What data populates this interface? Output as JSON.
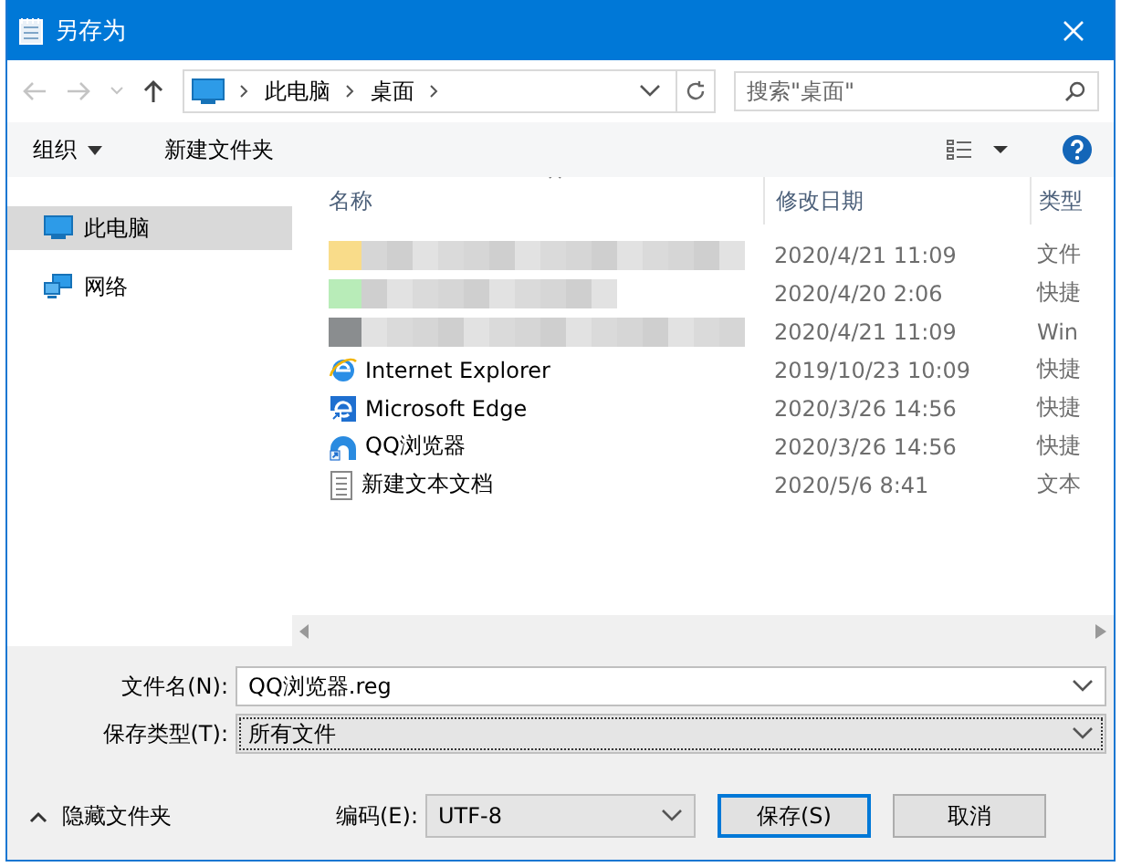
{
  "window": {
    "title": "另存为"
  },
  "address": {
    "path": [
      "此电脑",
      "桌面"
    ]
  },
  "search": {
    "placeholder": "搜索\"桌面\""
  },
  "toolbar": {
    "organize": "组织",
    "new_folder": "新建文件夹"
  },
  "sidebar": {
    "items": [
      {
        "label": "此电脑",
        "selected": true
      },
      {
        "label": "网络",
        "selected": false
      }
    ]
  },
  "table": {
    "columns": [
      "名称",
      "修改日期",
      "类型"
    ],
    "rows": [
      {
        "kind": "blurred",
        "date": "2020/4/21 11:09",
        "type": "文件"
      },
      {
        "kind": "blurred",
        "date": "2020/4/20 2:06",
        "type": "快捷"
      },
      {
        "kind": "blurred",
        "date": "2020/4/21 11:09",
        "type": "Win"
      },
      {
        "kind": "ie",
        "name": "Internet Explorer",
        "date": "2019/10/23 10:09",
        "type": "快捷"
      },
      {
        "kind": "edge",
        "name": "Microsoft Edge",
        "date": "2020/3/26 14:56",
        "type": "快捷"
      },
      {
        "kind": "qq",
        "name": "QQ浏览器",
        "date": "2020/3/26 14:56",
        "type": "快捷"
      },
      {
        "kind": "text",
        "name": "新建文本文档",
        "date": "2020/5/6 8:41",
        "type": "文本"
      }
    ]
  },
  "file_name": {
    "label": "文件名(N):",
    "value": "QQ浏览器.reg"
  },
  "save_type": {
    "label": "保存类型(T):",
    "value": "所有文件"
  },
  "hide_folders": "隐藏文件夹",
  "encoding": {
    "label": "编码(E):",
    "value": "UTF-8"
  },
  "buttons": [
    "保存(S)",
    "取消"
  ]
}
